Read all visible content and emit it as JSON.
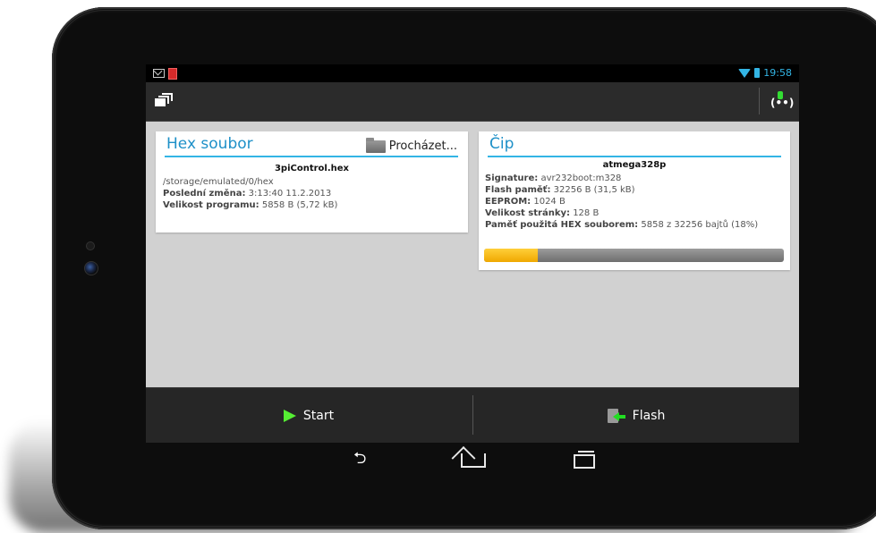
{
  "status_bar": {
    "time": "19:58",
    "icons": [
      "gmail-icon",
      "sd-card-icon",
      "wifi-icon",
      "battery-icon"
    ]
  },
  "action_bar": {
    "home_icon": "stacked-windows-icon",
    "connection_icon": "bluetooth-connection-icon",
    "connection_label": "(••)"
  },
  "hex_card": {
    "title": "Hex soubor",
    "browse_label": "Procházet...",
    "file_name": "3piControl.hex",
    "path": "/storage/emulated/0/hex",
    "last_change_label": "Poslední změna:",
    "last_change_value": "3:13:40 11.2.2013",
    "program_size_label": "Velikost programu:",
    "program_size_value": "5858 B (5,72 kB)"
  },
  "chip_card": {
    "title": "Čip",
    "chip_name": "atmega328p",
    "signature_label": "Signature:",
    "signature_value": "avr232boot:m328",
    "flash_label": "Flash paměť:",
    "flash_value": "32256 B (31,5 kB)",
    "eeprom_label": "EEPROM:",
    "eeprom_value": "1024 B",
    "page_size_label": "Velikost stránky:",
    "page_size_value": "128 B",
    "memory_used_label": "Paměť použitá HEX souborem:",
    "memory_used_value": "5858 z 32256 bajtů (18%)",
    "memory_used_fraction": 0.18
  },
  "bottom_bar": {
    "start_label": "Start",
    "flash_label": "Flash"
  },
  "colors": {
    "accent": "#33b5e5",
    "progress_fill": "#f0a800",
    "start_icon": "#55ee33"
  }
}
